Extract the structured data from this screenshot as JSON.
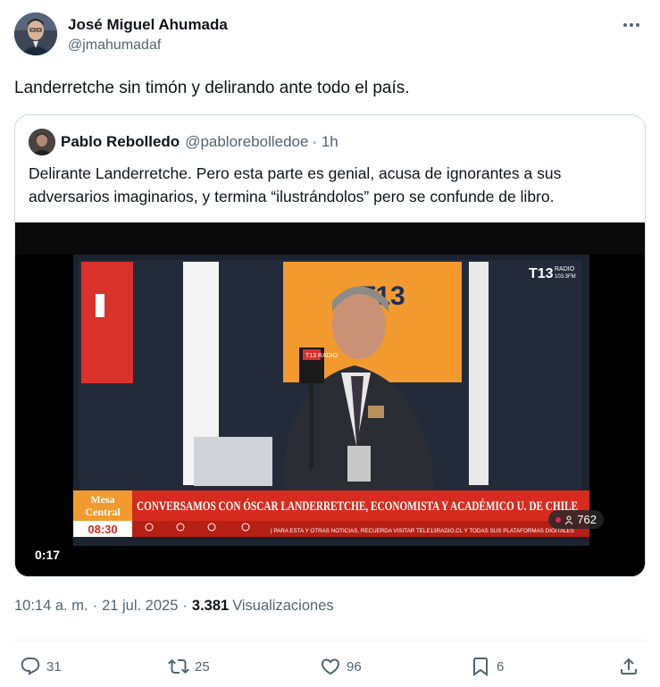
{
  "author": {
    "name": "José Miguel Ahumada",
    "handle": "@jmahumadaf"
  },
  "tweet": {
    "text": "Landerretche sin timón y delirando ante todo el país."
  },
  "quote": {
    "name": "Pablo Rebolledo",
    "handle": "@pablorebolledoe",
    "time": "· 1h",
    "text": "Delirante Landerretche. Pero esta parte es genial, acusa de ignorantes a sus adversarios imaginarios, y termina “ilustrándolos” pero se confunde de libro.",
    "video": {
      "duration": "0:17",
      "views": "762",
      "channel_logo": "T13",
      "channel_sub": "RADIO",
      "channel_freq": "103.3FM",
      "mic_label": "T13 RADIO",
      "program_top": "Mesa",
      "program_bottom": "Central",
      "clock": "08:30",
      "headline": "CONVERSAMOS CON ÓSCAR LANDERRETCHE, ECONOMISTA Y ACADÉMICO U. DE CHILE",
      "ticker": "| PARA ESTA Y OTRAS NOTICIAS, RECUERDA VISITAR TELE13RADIO.CL Y TODAS SUS PLATAFORMAS DIGITALES"
    }
  },
  "meta": {
    "time": "10:14 a. m.",
    "date": "21 jul. 2025",
    "views_count": "3.381",
    "views_label": "Visualizaciones"
  },
  "actions": {
    "replies": "31",
    "retweets": "25",
    "likes": "96",
    "bookmarks": "6"
  },
  "colors": {
    "text": "#0f1419",
    "secondary": "#536471",
    "border": "#cfd9de",
    "ticker_red": "#d62b1e",
    "orange": "#f29a2e"
  }
}
